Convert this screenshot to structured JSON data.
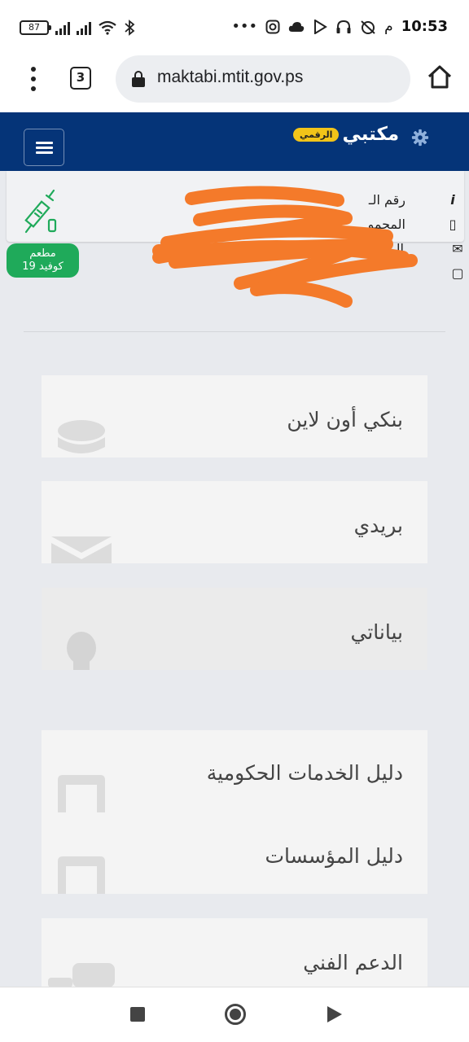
{
  "status_bar": {
    "battery": "87",
    "time": "10:53",
    "period": "م"
  },
  "browser": {
    "tab_count": "3",
    "url": "maktabi.mtit.gov.ps"
  },
  "header": {
    "title": "مكتبي",
    "badge": "الرقمي",
    "background": "#053478"
  },
  "info": {
    "row1": "رقم الـ",
    "row2": "المحمو",
    "row3": "الـ",
    "row4": ""
  },
  "covid_badge": {
    "line1": "مطعم",
    "line2": "كوفيد 19",
    "color": "#1faa5a"
  },
  "services": {
    "bank": "بنكي أون لاين",
    "mail": "بريدي",
    "my_data": "بياناتي",
    "gov_services": "دليل الخدمات الحكومية",
    "institutions": "دليل المؤسسات",
    "support": "الدعم الفني"
  },
  "icons": {
    "settings": "gear-icon",
    "bank": "database-icon",
    "mail": "envelope-icon",
    "my_data": "user-icon",
    "gov_services": "folder-icon",
    "institutions": "folder-icon",
    "support": "chat-icon"
  }
}
